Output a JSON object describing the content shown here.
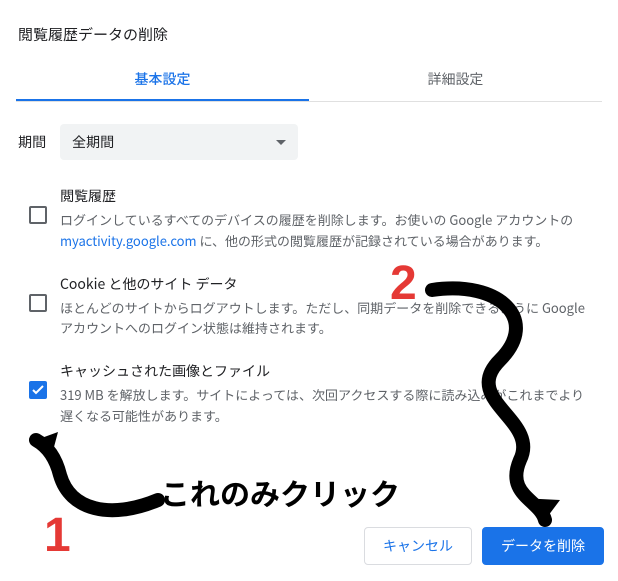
{
  "dialog": {
    "title": "閲覧履歴データの削除"
  },
  "tabs": {
    "basic": "基本設定",
    "advanced": "詳細設定"
  },
  "range": {
    "label": "期間",
    "value": "全期間"
  },
  "options": {
    "history": {
      "title": "閲覧履歴",
      "desc_before": "ログインしているすべてのデバイスの履歴を削除します。お使いの Google アカウントの ",
      "link_text": "myactivity.google.com",
      "desc_after": " に、他の形式の閲覧履歴が記録されている場合があります。",
      "checked": false
    },
    "cookies": {
      "title": "Cookie と他のサイト データ",
      "desc": "ほとんどのサイトからログアウトします。ただし、同期データを削除できるように Google アカウントへのログイン状態は維持されます。",
      "checked": false
    },
    "cache": {
      "title": "キャッシュされた画像とファイル",
      "desc": "319 MB を解放します。サイトによっては、次回アクセスする際に読み込みがこれまでより遅くなる可能性があります。",
      "checked": true
    }
  },
  "buttons": {
    "cancel": "キャンセル",
    "confirm": "データを削除"
  },
  "annotations": {
    "one": "1",
    "two": "2",
    "click_this": "これのみクリック"
  }
}
